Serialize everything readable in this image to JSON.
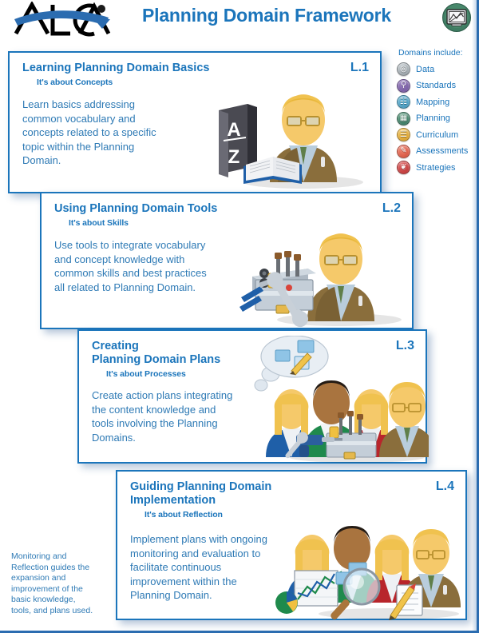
{
  "header": {
    "logo_text": "ALCA",
    "logo_name": "alca-logo",
    "title": "Planning Domain Framework",
    "icon_name": "planning-domain-icon"
  },
  "legend": {
    "title": "Domains include:",
    "items": [
      {
        "label": "Data",
        "color": "#9aa3a8",
        "icon": "data-icon",
        "glyph": "◎"
      },
      {
        "label": "Standards",
        "color": "#7b5ea7",
        "icon": "standards-icon",
        "glyph": "⚲"
      },
      {
        "label": "Mapping",
        "color": "#4aa0c4",
        "icon": "mapping-icon",
        "glyph": "☷"
      },
      {
        "label": "Planning",
        "color": "#3f7d63",
        "icon": "planning-icon",
        "glyph": "▦"
      },
      {
        "label": "Curriculum",
        "color": "#e0a732",
        "icon": "curriculum-icon",
        "glyph": "☰"
      },
      {
        "label": "Assessments",
        "color": "#e05a46",
        "icon": "assessments-icon",
        "glyph": "✎"
      },
      {
        "label": "Strategies",
        "color": "#cc3a3a",
        "icon": "strategies-icon",
        "glyph": "❦"
      }
    ]
  },
  "cards": [
    {
      "level": "L.1",
      "title": "Learning Planning Domain Basics",
      "subtitle": "It's about Concepts",
      "body": "Learn basics addressing\ncommon vocabulary and\nconcepts related to a specific\ntopic within the Planning\nDomain.",
      "art_name": "teacher-with-dictionary-illustration"
    },
    {
      "level": "L.2",
      "title": "Using Planning Domain Tools",
      "subtitle": "It's about Skills",
      "body": "Use tools to integrate vocabulary\nand concept knowledge with\ncommon skills and best practices\nall related to Planning Domain.",
      "art_name": "teacher-with-toolbox-illustration"
    },
    {
      "level": "L.3",
      "title": "Creating\nPlanning Domain Plans",
      "subtitle": "It's about Processes",
      "body": "Create action plans integrating\nthe content knowledge and\ntools involving the Planning\nDomains.",
      "art_name": "team-planning-illustration"
    },
    {
      "level": "L.4",
      "title": "Guiding Planning Domain\nImplementation",
      "subtitle": "It's about Reflection",
      "body": "Implement plans with ongoing\nmonitoring and evaluation to\nfacilitate continuous\nimprovement within the\nPlanning Domain.",
      "art_name": "team-analysis-illustration"
    }
  ],
  "footer": {
    "note": "Monitoring and\nReflection guides the\nexpansion and\nimprovement of the\nbasic knowledge,\ntools, and plans used."
  },
  "colors": {
    "brand_blue": "#1b75bb",
    "body_blue": "#2e7ab5",
    "border_blue": "#1b75bb"
  }
}
